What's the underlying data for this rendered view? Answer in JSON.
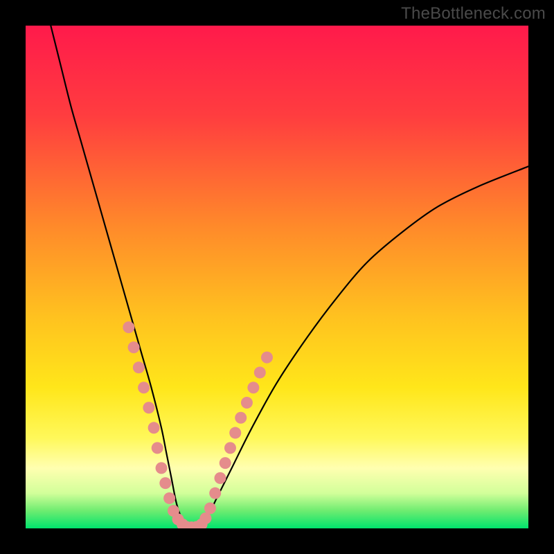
{
  "watermark": "TheBottleneck.com",
  "chart_data": {
    "type": "line",
    "title": "",
    "xlabel": "",
    "ylabel": "",
    "xlim": [
      0,
      100
    ],
    "ylim": [
      0,
      100
    ],
    "grid": false,
    "legend": false,
    "background_gradient_stops": [
      {
        "offset": 0.0,
        "color": "#ff1a4b"
      },
      {
        "offset": 0.18,
        "color": "#ff3d3f"
      },
      {
        "offset": 0.4,
        "color": "#ff8a2a"
      },
      {
        "offset": 0.58,
        "color": "#ffc21f"
      },
      {
        "offset": 0.72,
        "color": "#ffe61a"
      },
      {
        "offset": 0.82,
        "color": "#fff85a"
      },
      {
        "offset": 0.88,
        "color": "#ffffb0"
      },
      {
        "offset": 0.93,
        "color": "#d2ff9a"
      },
      {
        "offset": 0.965,
        "color": "#6eec70"
      },
      {
        "offset": 1.0,
        "color": "#00e36d"
      }
    ],
    "series": [
      {
        "name": "bottleneck-curve",
        "x": [
          5,
          7,
          9,
          11,
          13,
          15,
          17,
          19,
          21,
          23,
          25,
          27,
          28,
          29,
          30,
          31,
          32,
          34,
          36,
          38,
          41,
          45,
          50,
          56,
          62,
          68,
          75,
          82,
          90,
          100
        ],
        "y": [
          100,
          92,
          84,
          77,
          70,
          63,
          56,
          49,
          42,
          35,
          28,
          20,
          15,
          10,
          5,
          2,
          0,
          0,
          2,
          6,
          12,
          20,
          29,
          38,
          46,
          53,
          59,
          64,
          68,
          72
        ]
      }
    ],
    "highlight_points": {
      "name": "highlight-dots",
      "color": "#e58c8c",
      "points_xy": [
        [
          20.5,
          40
        ],
        [
          21.5,
          36
        ],
        [
          22.5,
          32
        ],
        [
          23.5,
          28
        ],
        [
          24.5,
          24
        ],
        [
          25.5,
          20
        ],
        [
          26.2,
          16
        ],
        [
          27.0,
          12
        ],
        [
          27.8,
          9
        ],
        [
          28.6,
          6
        ],
        [
          29.4,
          3.5
        ],
        [
          30.3,
          1.8
        ],
        [
          31.2,
          0.8
        ],
        [
          32.0,
          0.3
        ],
        [
          33.0,
          0.2
        ],
        [
          34.0,
          0.3
        ],
        [
          35.0,
          0.8
        ],
        [
          35.8,
          2
        ],
        [
          36.7,
          4
        ],
        [
          37.7,
          7
        ],
        [
          38.7,
          10
        ],
        [
          39.7,
          13
        ],
        [
          40.7,
          16
        ],
        [
          41.7,
          19
        ],
        [
          42.8,
          22
        ],
        [
          44.0,
          25
        ],
        [
          45.3,
          28
        ],
        [
          46.6,
          31
        ],
        [
          48.0,
          34
        ]
      ]
    }
  }
}
